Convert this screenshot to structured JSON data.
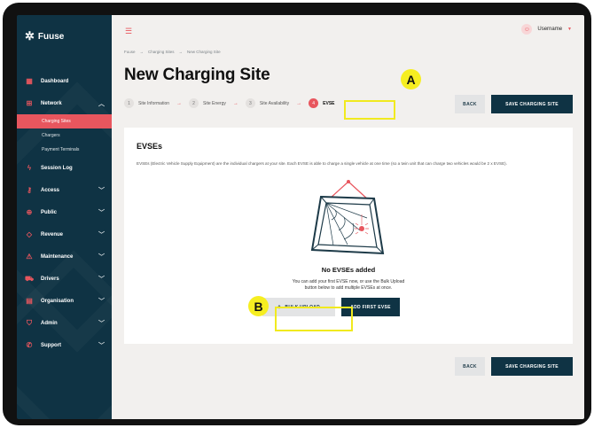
{
  "app": {
    "brand": "Fuuse"
  },
  "header": {
    "username": "Username"
  },
  "breadcrumb": {
    "items": [
      "Fuuse",
      "Charging Sites",
      "New Charging Site"
    ]
  },
  "page": {
    "title": "New Charging Site"
  },
  "steps": [
    {
      "num": "1",
      "label": "Site Information"
    },
    {
      "num": "2",
      "label": "Site Energy"
    },
    {
      "num": "3",
      "label": "Site Availability"
    },
    {
      "num": "4",
      "label": "EVSE"
    }
  ],
  "actions": {
    "back": "BACK",
    "save": "SAVE CHARGING SITE"
  },
  "sidebar": {
    "items": [
      {
        "label": "Dashboard",
        "icon": "dashboard-icon"
      },
      {
        "label": "Network",
        "icon": "network-icon"
      },
      {
        "label": "Session Log",
        "icon": "lightning-icon"
      },
      {
        "label": "Access",
        "icon": "key-icon"
      },
      {
        "label": "Public",
        "icon": "globe-icon"
      },
      {
        "label": "Revenue",
        "icon": "tag-icon"
      },
      {
        "label": "Maintenance",
        "icon": "warning-icon"
      },
      {
        "label": "Drivers",
        "icon": "car-icon"
      },
      {
        "label": "Organisation",
        "icon": "building-icon"
      },
      {
        "label": "Admin",
        "icon": "shield-icon"
      },
      {
        "label": "Support",
        "icon": "phone-icon"
      }
    ],
    "network_sub": [
      "Charging Sites",
      "Chargers",
      "Payment Terminals"
    ]
  },
  "evse": {
    "title": "EVSEs",
    "description": "EVSEs (Electric Vehicle Supply Equipment) are the individual chargers at your site. Each EVSE is able to charge a single vehicle at one time (so a twin unit that can charge two vehicles would be 2 x EVSE).",
    "empty_title": "No EVSEs added",
    "empty_text": "You can add your first EVSE now, or use the Bulk Upload button below to add multiple EVSEs at once.",
    "bulk_upload": "BULK UPLOAD",
    "add_first": "ADD FIRST EVSE"
  },
  "annotations": {
    "a": "A",
    "b": "B"
  },
  "colors": {
    "accent": "#e8565e",
    "navy": "#0f3344",
    "highlight": "#f6ee21"
  }
}
